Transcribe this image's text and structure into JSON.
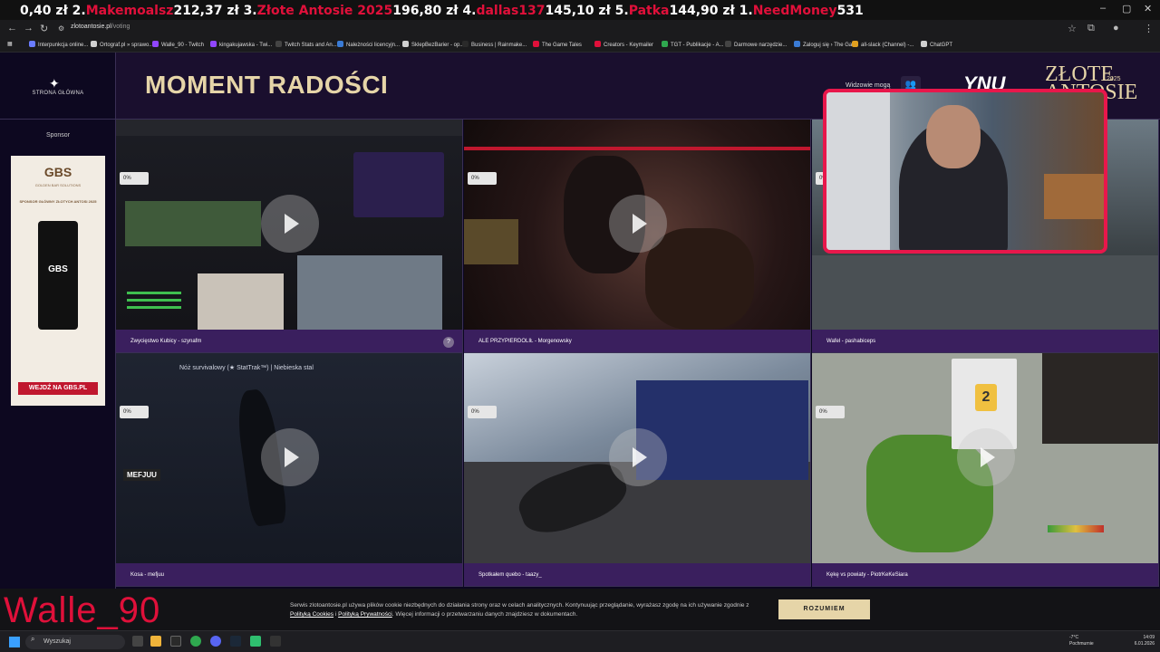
{
  "browser": {
    "ticker": [
      {
        "text": "0,40 zł 2.",
        "color": "white"
      },
      {
        "text": "Makemoalsz",
        "color": "red"
      },
      {
        "text": "212,37 zł 3.",
        "color": "white"
      },
      {
        "text": "Złote Antosie 2025",
        "color": "red"
      },
      {
        "text": "196,80 zł 4.",
        "color": "white"
      },
      {
        "text": "dallas137",
        "color": "red"
      },
      {
        "text": "145,10 zł 5.",
        "color": "white"
      },
      {
        "text": "Patka",
        "color": "red"
      },
      {
        "text": "144,90 zł",
        "color": "white"
      },
      {
        "text": " 1.",
        "color": "white"
      },
      {
        "text": "NeedMoney",
        "color": "red"
      },
      {
        "text": "531",
        "color": "white"
      }
    ],
    "url_domain": "zlotoantosie.pl",
    "url_path": "/voting",
    "bookmarks": [
      {
        "label": "Interpunkcja online...",
        "color": "#6a7cff"
      },
      {
        "label": "Ortograf.pl » sprawo...",
        "color": "#d0d0d0"
      },
      {
        "label": "Walle_90 - Twitch",
        "color": "#9146ff"
      },
      {
        "label": "kingakujawska - Twi...",
        "color": "#9146ff"
      },
      {
        "label": "Twitch Stats and An...",
        "color": "#444"
      },
      {
        "label": "Należności licencyjn...",
        "color": "#3a7bd5"
      },
      {
        "label": "SklepBezBarier - op...",
        "color": "#d0d0d0"
      },
      {
        "label": "Business | Rainmake...",
        "color": "#2a2a2a"
      },
      {
        "label": "The Game Tales",
        "color": "#e0103a"
      },
      {
        "label": "Creators - Keymailer",
        "color": "#e0103a"
      },
      {
        "label": "TGT - Publikacje - A...",
        "color": "#2fa84f"
      },
      {
        "label": "Darmowe narzędzie...",
        "color": "#444"
      },
      {
        "label": "Zaloguj się › The Ga...",
        "color": "#3a7bd5"
      },
      {
        "label": "all-slack (Channel) -...",
        "color": "#e0a020"
      },
      {
        "label": "ChatGPT",
        "color": "#d0d0d0"
      }
    ]
  },
  "nav": {
    "home_label": "STRONA GŁÓWNA",
    "sponsor_label": "Sponsor"
  },
  "ad": {
    "logo": "GBS",
    "logo_sub": "GOLDEN BAR SOLUTIONS",
    "tagline": "SPONSOR GŁÓWNY ZŁOTYCH ANTOSI 2025",
    "can_text": "GBS",
    "cta": "WEJDŹ NA GBS.PL"
  },
  "header": {
    "title": "MOMENT RADOŚCI",
    "watchers": "Widzowie mogą",
    "brand_script": "YNU",
    "brand_name": "ZŁOTE ANTOSIE",
    "brand_year": "2025"
  },
  "tiles": [
    {
      "caption": "Zwycięstwo Kubicy - szynafm",
      "pct": "0%",
      "help": "?"
    },
    {
      "caption": "ALE PRZYPIERDOLIŁ - Morgenowsky",
      "pct": "0%"
    },
    {
      "caption": "Wafel - pashabiceps",
      "pct": "0%"
    },
    {
      "caption": "Kosa - mefjuu",
      "pct": "0%"
    },
    {
      "caption": "Spotkałem quebo - taazy_",
      "pct": "0%"
    },
    {
      "caption": "Kękę vs powiaty - PiotrKeKeSiara",
      "pct": "0%"
    }
  ],
  "thumb_overlays": {
    "kosa_title": "Nóż survivalowy (★ StatTrak™) | Niebieska stal",
    "kosa_name": "MEFJUU",
    "quiz_number": "2"
  },
  "stream_overlay": {
    "streamer": "Walle_90"
  },
  "cookie": {
    "text1": "Serwis zlotoantosie.pl używa plików cookie niezbędnych do działania strony oraz w celach analitycznych. Kontynuując przeglądanie, wyrażasz zgodę na ich używanie zgodnie z ",
    "link1": "Polityką Cookies",
    "and": " i ",
    "link2": "Polityką Prywatności",
    "text2": ". Więcej informacji o przetwarzaniu danych znajdziesz w dokumentach.",
    "accept": "ROZUMIEM"
  },
  "taskbar": {
    "search": "Wyszukaj",
    "weather_temp": "-7°C",
    "weather_desc": "Pochmurnie",
    "time": "14:09",
    "date": "6.01.2026"
  }
}
